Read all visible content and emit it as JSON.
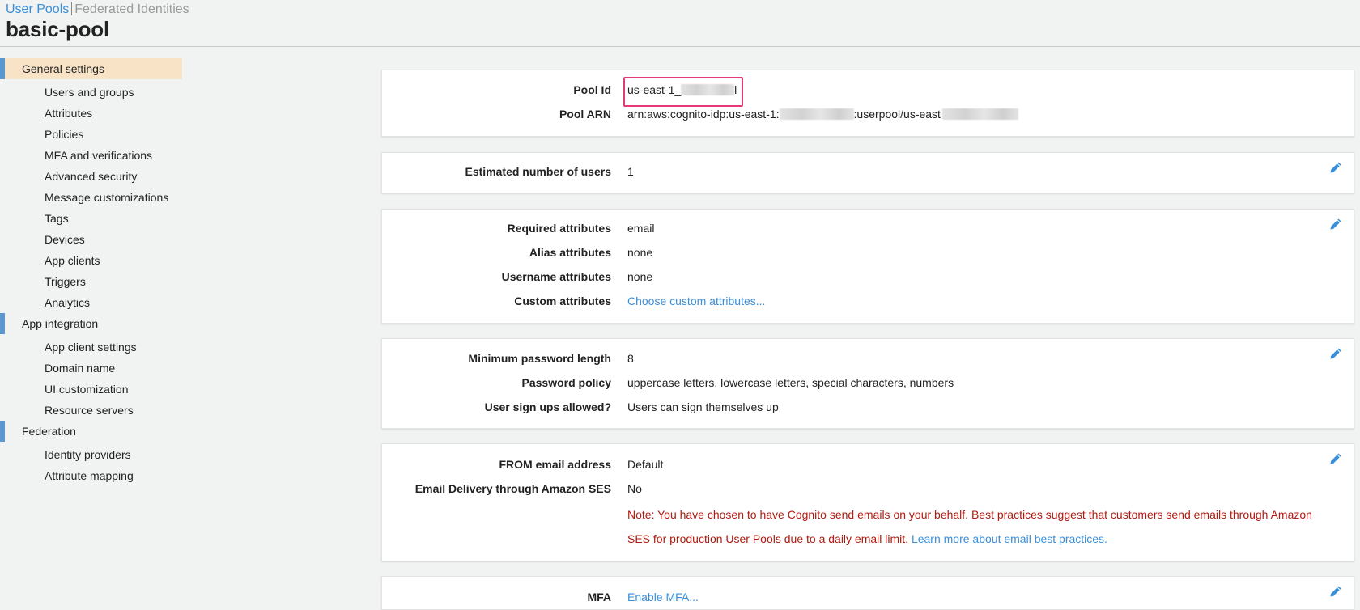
{
  "breadcrumb": {
    "user_pools": "User Pools",
    "federated": "Federated Identities"
  },
  "page_title": "basic-pool",
  "sidebar": {
    "sections": [
      {
        "label": "General settings",
        "active": true,
        "items": [
          "Users and groups",
          "Attributes",
          "Policies",
          "MFA and verifications",
          "Advanced security",
          "Message customizations",
          "Tags",
          "Devices",
          "App clients",
          "Triggers",
          "Analytics"
        ]
      },
      {
        "label": "App integration",
        "active": false,
        "items": [
          "App client settings",
          "Domain name",
          "UI customization",
          "Resource servers"
        ]
      },
      {
        "label": "Federation",
        "active": false,
        "items": [
          "Identity providers",
          "Attribute mapping"
        ]
      }
    ]
  },
  "pool": {
    "id_label": "Pool Id",
    "id_value": "us-east-1_",
    "id_tail": "l",
    "arn_label": "Pool ARN",
    "arn_prefix": "arn:aws:cognito-idp:us-east-1:",
    "arn_middle": ":userpool/us-east"
  },
  "users": {
    "label": "Estimated number of users",
    "value": "1"
  },
  "attributes": {
    "required_label": "Required attributes",
    "required_value": "email",
    "alias_label": "Alias attributes",
    "alias_value": "none",
    "username_label": "Username attributes",
    "username_value": "none",
    "custom_label": "Custom attributes",
    "custom_link": "Choose custom attributes..."
  },
  "password": {
    "min_label": "Minimum password length",
    "min_value": "8",
    "policy_label": "Password policy",
    "policy_value": "uppercase letters, lowercase letters, special characters, numbers",
    "signup_label": "User sign ups allowed?",
    "signup_value": "Users can sign themselves up"
  },
  "email": {
    "from_label": "FROM email address",
    "from_value": "Default",
    "ses_label": "Email Delivery through Amazon SES",
    "ses_value": "No",
    "note_line1": "Note: You have chosen to have Cognito send emails on your behalf. Best practices suggest that customers send emails through Amazon",
    "note_line2": "SES for production User Pools due to a daily email limit.",
    "note_link": "Learn more about email best practices."
  },
  "mfa": {
    "label": "MFA",
    "link": "Enable MFA..."
  },
  "colors": {
    "accent": "#3a8fd9",
    "active_bg": "#f8e3c7",
    "marker": "#5d97cf",
    "note": "#b01a0f",
    "highlight": "#e5397a"
  },
  "icons": {
    "edit": "pencil-icon"
  }
}
